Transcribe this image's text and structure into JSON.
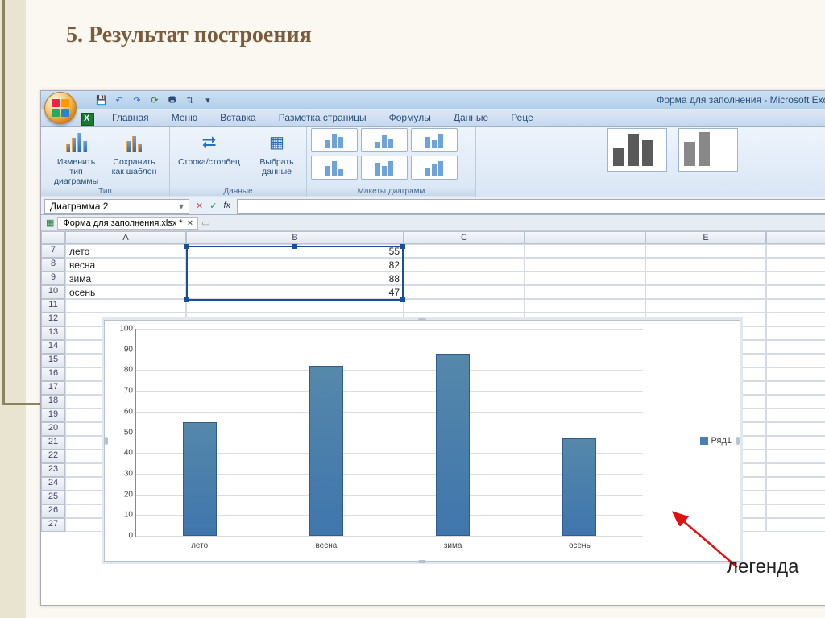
{
  "slide": {
    "title": "5. Результат построения"
  },
  "window": {
    "title": "Форма для заполнения - Microsoft Excel"
  },
  "ribbon": {
    "tabs": [
      "Главная",
      "Меню",
      "Вставка",
      "Разметка страницы",
      "Формулы",
      "Данные",
      "Реце"
    ],
    "groups": [
      {
        "label": "Тип",
        "buttons": [
          "Изменить тип диаграммы",
          "Сохранить как шаблон"
        ]
      },
      {
        "label": "Данные",
        "buttons": [
          "Строка/столбец",
          "Выбрать данные"
        ]
      },
      {
        "label": "Макеты диаграмм",
        "buttons": []
      }
    ]
  },
  "formulaBar": {
    "nameBox": "Диаграмма 2"
  },
  "docTab": {
    "name": "Форма для заполнения.xlsx *"
  },
  "sheet": {
    "columns": [
      "A",
      "B",
      "C",
      "",
      "E",
      ""
    ],
    "startRow": 7,
    "rows": [
      {
        "n": 7,
        "A": "лето",
        "B": 55
      },
      {
        "n": 8,
        "A": "весна",
        "B": 82
      },
      {
        "n": 9,
        "A": "зима",
        "B": 88
      },
      {
        "n": 10,
        "A": "осень",
        "B": 47
      },
      {
        "n": 11
      },
      {
        "n": 12
      },
      {
        "n": 13
      },
      {
        "n": 14
      },
      {
        "n": 15
      },
      {
        "n": 16
      },
      {
        "n": 17
      },
      {
        "n": 18
      },
      {
        "n": 19
      },
      {
        "n": 20
      },
      {
        "n": 21
      },
      {
        "n": 22
      },
      {
        "n": 23
      },
      {
        "n": 24
      },
      {
        "n": 25
      },
      {
        "n": 26
      },
      {
        "n": 27
      }
    ]
  },
  "chart_data": {
    "type": "bar",
    "categories": [
      "лето",
      "весна",
      "зима",
      "осень"
    ],
    "series": [
      {
        "name": "Ряд1",
        "values": [
          55,
          82,
          88,
          47
        ]
      }
    ],
    "ylim": [
      0,
      100
    ],
    "ystep": 10,
    "xlabel": "",
    "ylabel": "",
    "title": ""
  },
  "annotation": {
    "text": "легенда"
  },
  "colors": {
    "bar": "#4a7db3",
    "accent": "#1a4f9a"
  }
}
